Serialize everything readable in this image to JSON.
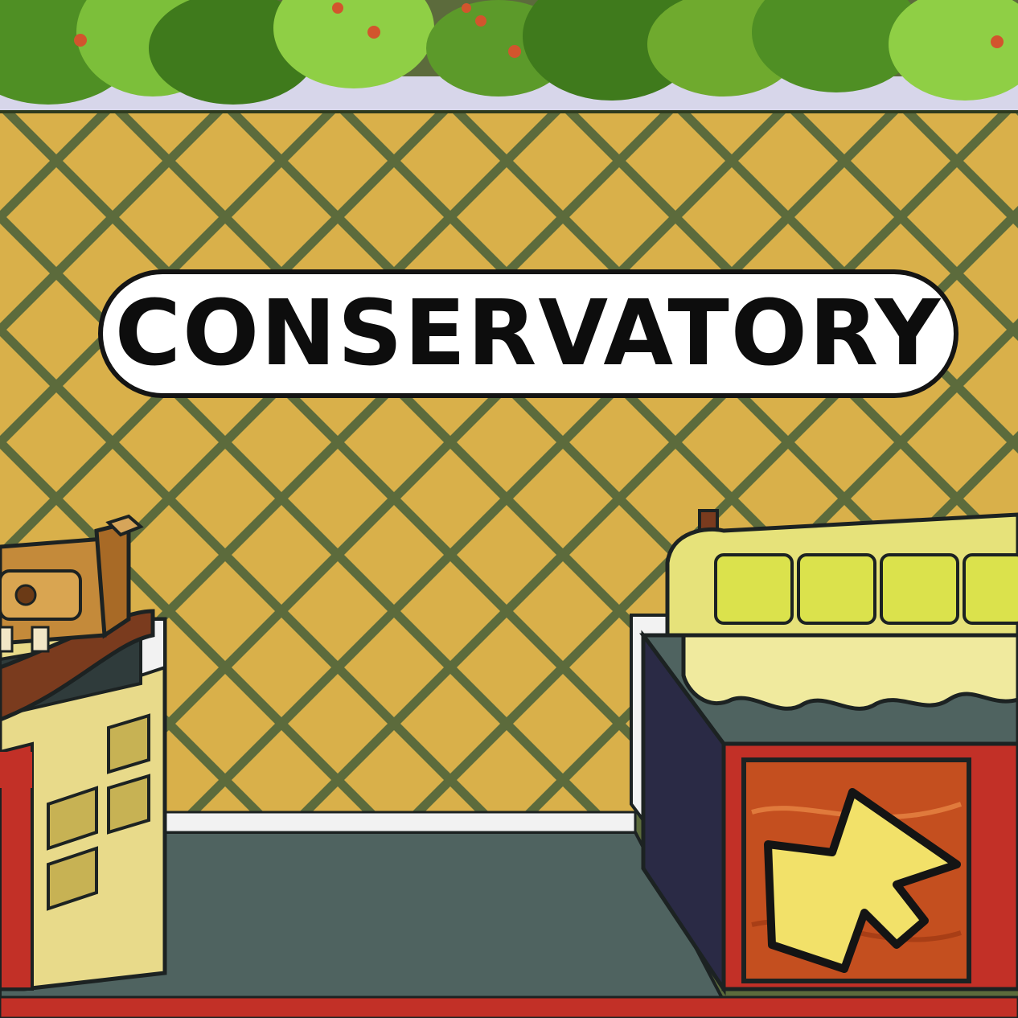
{
  "room": {
    "title": "CONSERVATORY"
  },
  "colors": {
    "wall_dark": "#5c6b3c",
    "wall_light": "#d9b04a",
    "floor": "#4f6360",
    "planter_red": "#c23027",
    "planter_body": "#2f3b3b",
    "sofa": "#e6e27a",
    "sofa_cushion": "#dbe24c",
    "arrow": "#f2e169",
    "crate": "#c44f1f",
    "foliage": "#6faa2e",
    "baseboard": "#f2f2f2"
  },
  "icons": {
    "exit_arrow": "arrow-down-left-icon"
  }
}
